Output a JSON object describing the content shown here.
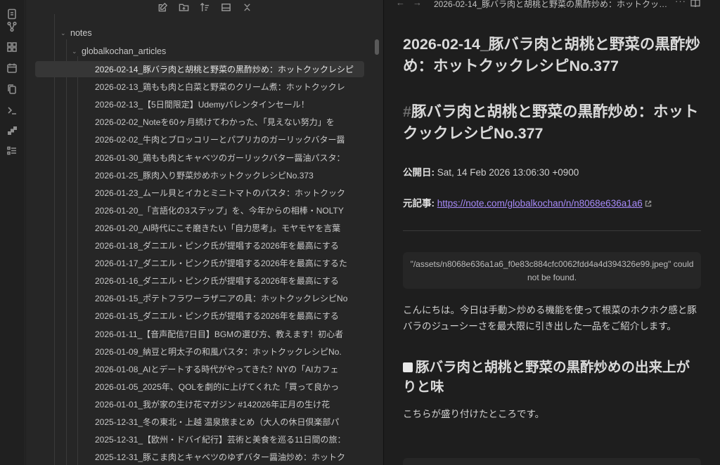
{
  "explorer": {
    "folders": {
      "notes": "notes",
      "articles": "globalkochan_articles"
    },
    "files": [
      "2026-02-14_豚バラ肉と胡桃と野菜の黒酢炒め：ホットクックレシピ",
      "2026-02-13_鶏もも肉と白菜と野菜のクリーム煮：ホットクックレ",
      "2026-02-13_【5日間限定】Udemyバレンタインセール！",
      "2026-02-02_Noteを60ヶ月続けてわかった、「見えない努力」を",
      "2026-02-02_牛肉とブロッコリーとパプリカのガーリックバター醤",
      "2026-01-30_鶏もも肉とキャベツのガーリックバター醤油パスタ：",
      "2026-01-25_豚肉入り野菜炒めホットクックレシピNo.373",
      "2026-01-23_ムール貝とイカとミニトマトのパスタ：ホットクック",
      "2026-01-20_「言語化の3ステップ」を、今年からの相棒・NOLTY",
      "2026-01-20_AI時代にこそ磨きたい「自力思考」。モヤモヤを言葉",
      "2026-01-18_ダニエル・ピンク氏が提唱する2026年を最高にする",
      "2026-01-17_ダニエル・ピンク氏が提唱する2026年を最高にするた",
      "2026-01-16_ダニエル・ピンク氏が提唱する2026年を最高にする",
      "2026-01-15_ポテトフラワーラザニアの具：ホットクックレシピNo",
      "2026-01-15_ダニエル・ピンク氏が提唱する2026年を最高にする",
      "2026-01-11_【音声配信7日目】BGMの選び方、教えます！初心者",
      "2026-01-09_納豆と明太子の和風パスタ：ホットクックレシピNo.",
      "2026-01-08_AIとデートする時代がやってきた？NYの「AIカフェ",
      "2026-01-05_2025年、QOLを劇的に上げてくれた「買って良かっ",
      "2026-01-01_我が家の生け花マガジン #142026年正月の生け花",
      "2025-12-31_冬の東北・上越 温泉旅まとめ（大人の休日倶楽部パ",
      "2025-12-31_【欧州・ドバイ紀行】芸術と美食を巡る11日間の旅：",
      "2025-12-31_豚こま肉とキャベツのゆずバター醤油炒め：ホットク"
    ]
  },
  "editor": {
    "header_title": "2026-02-14_豚バラ肉と胡桃と野菜の黒酢炒め：ホットクック…",
    "note_title": "2026-02-14_豚バラ肉と胡桃と野菜の黒酢炒め：ホットクックレシピNo.377",
    "h1_hash": "#",
    "h1": "豚バラ肉と胡桃と野菜の黒酢炒め：ホットクックレシピNo.377",
    "published_label": "公開日:",
    "published_value": " Sat, 14 Feb 2026 13:06:30 +0900",
    "source_label": "元記事:",
    "source_link": "https://note.com/globalkochan/n/n8068e636a1a6",
    "missing_embed": "\"/assets/n8068e636a1a6_f0e83c884cfc0062fdd4a4d394326e99.jpeg\" could not be found.",
    "paragraph": "こんにちは。今日は手動＞炒める機能を使って根菜のホクホク感と豚バラのジューシーさを最大限に引き出した一品をご紹介します。",
    "h2": "豚バラ肉と胡桃と野菜の黒酢炒めの出来上がりと味",
    "paragraph2": "こちらが盛り付けたところです。"
  },
  "icons": {
    "ribbon": [
      "files-icon",
      "graph-icon",
      "layout-icon",
      "calendar-icon",
      "copy-icon",
      "terminal-icon",
      "stack-icon",
      "list-icon"
    ],
    "toolbar": [
      "new-note-icon",
      "new-folder-icon",
      "sort-icon",
      "collapse-icon",
      "close-icon"
    ]
  },
  "colors": {
    "accent_link": "#a88bfa",
    "background": "#1e1e1e",
    "sidebar": "#262626",
    "active_row": "#363636"
  }
}
